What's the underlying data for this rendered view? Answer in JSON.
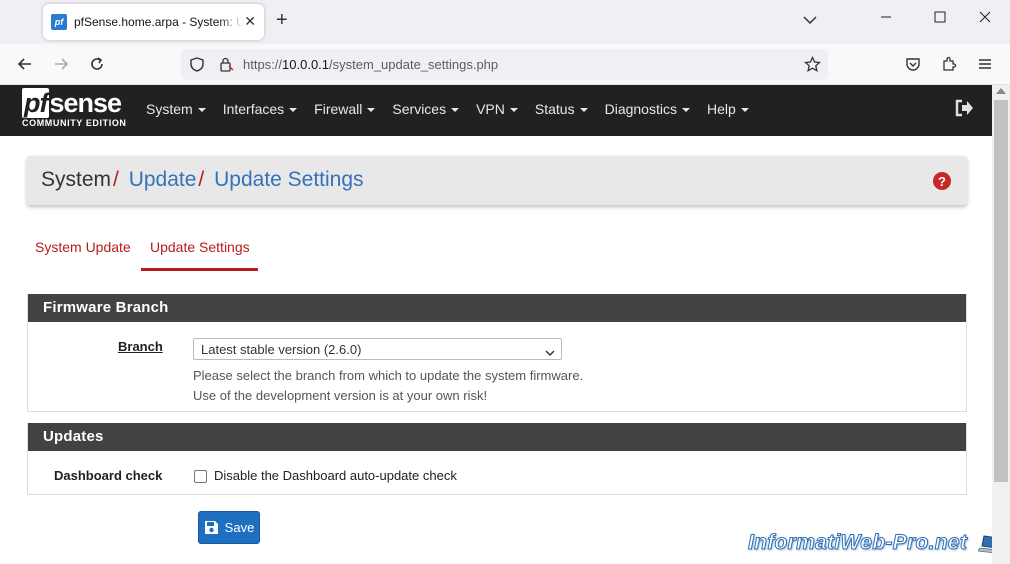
{
  "browser": {
    "tab_title": "pfSense.home.arpa - System: Update: Update Settings",
    "favicon_text": "pf",
    "url_scheme": "https://",
    "url_host": "10.0.0.1",
    "url_path": "/system_update_settings.php"
  },
  "header": {
    "logo_main": "sense",
    "logo_pf": "pf",
    "logo_sub": "COMMUNITY EDITION",
    "menu": [
      "System",
      "Interfaces",
      "Firewall",
      "Services",
      "VPN",
      "Status",
      "Diagnostics",
      "Help"
    ]
  },
  "breadcrumb": {
    "root": "System",
    "sep": "/",
    "level1": "Update",
    "level2": "Update Settings"
  },
  "tabs": [
    {
      "label": "System Update",
      "active": false
    },
    {
      "label": "Update Settings",
      "active": true
    }
  ],
  "firmware": {
    "heading": "Firmware Branch",
    "branch_label": "Branch",
    "branch_value": "Latest stable version (2.6.0)",
    "help_line1": "Please select the branch from which to update the system firmware.",
    "help_line2": "Use of the development version is at your own risk!"
  },
  "updates": {
    "heading": "Updates",
    "dashboard_label": "Dashboard check",
    "checkbox_label": "Disable the Dashboard auto-update check",
    "checked": false
  },
  "actions": {
    "save_label": "Save"
  },
  "watermark": {
    "text": "InformatiWeb-Pro.net"
  },
  "colors": {
    "accent_red": "#b71c1c",
    "link_blue": "#3572b8",
    "header_dark": "#212121",
    "panel_head": "#424242",
    "save_blue": "#1e6fc0"
  }
}
